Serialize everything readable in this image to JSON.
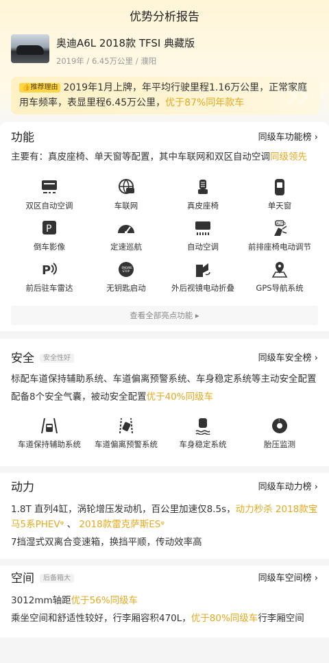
{
  "page": {
    "title": "优势分析报告"
  },
  "car": {
    "name": "奥迪A6L 2018款 TFSI 典藏版",
    "meta": "2019年 / 6.45万公里 / 濮阳"
  },
  "reason": {
    "tag": "推荐理由",
    "text": "2019年1月上牌，年平均行驶里程1.16万公里，正常家庭用车频率，表显里程6.45万公里，",
    "highlight": "优于87%同年款车"
  },
  "function": {
    "title": "功能",
    "rank_label": "同级车功能榜 ›",
    "desc": "主要有：真皮座椅、单天窗等配置，其中车联网和双区自动空调",
    "desc_hl": "同级领先",
    "items": [
      {
        "label": "双区自动空调",
        "icon": "dual-zone-ac-icon"
      },
      {
        "label": "车联网",
        "icon": "connected-car-icon"
      },
      {
        "label": "真皮座椅",
        "icon": "leather-seat-icon"
      },
      {
        "label": "单天窗",
        "icon": "sunroof-icon"
      },
      {
        "label": "倒车影像",
        "icon": "reverse-camera-icon"
      },
      {
        "label": "定速巡航",
        "icon": "cruise-control-icon"
      },
      {
        "label": "自动空调",
        "icon": "auto-ac-icon"
      },
      {
        "label": "前排座椅电动调节",
        "icon": "power-seat-icon"
      },
      {
        "label": "前后驻车雷达",
        "icon": "parking-radar-icon"
      },
      {
        "label": "无钥匙启动",
        "icon": "keyless-start-icon"
      },
      {
        "label": "外后视镜电动折叠",
        "icon": "mirror-fold-icon"
      },
      {
        "label": "GPS导航系统",
        "icon": "gps-icon"
      }
    ],
    "view_all": "查看全部亮点功能 ▸"
  },
  "safety": {
    "title": "安全",
    "badge": "安全性好",
    "rank_label": "同级车安全榜 ›",
    "desc1": "标配车道保持辅助系统、车道偏离预警系统、车身稳定系统等主动安全配置",
    "desc2": "配备8个安全气囊，被动安全配置",
    "desc2_hl": "优于40%同级车",
    "items": [
      {
        "label": "车道保持辅助系统",
        "icon": "lane-keep-icon"
      },
      {
        "label": "车道偏离预警系统",
        "icon": "lane-departure-icon"
      },
      {
        "label": "车身稳定系统",
        "icon": "stability-control-icon"
      },
      {
        "label": "胎压监测",
        "icon": "tire-pressure-icon"
      }
    ]
  },
  "power": {
    "title": "动力",
    "rank_label": "同级车动力榜 ›",
    "desc1": "1.8T 直列4缸，涡轮增压发动机，百公里加速仅8.5s，",
    "desc1_hl": "动力秒杀 2018款宝马5系PHEV",
    "desc1_sep": " 、 ",
    "desc1_hl2": "2018款雷克萨斯ES",
    "desc2": "7挡湿式双离合变速箱，换挡平顺，传动效率高"
  },
  "space": {
    "title": "空间",
    "badge": "后备箱大",
    "rank_label": "同级车空间榜 ›",
    "desc1": "3012mm轴距",
    "desc1_hl": "优于56%同级车",
    "desc2": "乘坐空间和舒适性较好，行李厢容积470L，",
    "desc2_hl": "优于80%同级车",
    "desc2_tail": "行李厢空间"
  }
}
